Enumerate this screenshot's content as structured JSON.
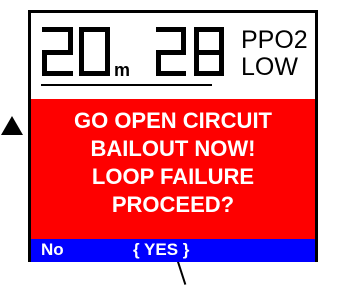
{
  "display": {
    "depth_value": "20",
    "depth_unit": "m",
    "time_value": "28",
    "ppo2_line1": "PPO2",
    "ppo2_line2": "LOW"
  },
  "alert": {
    "lines": [
      "GO OPEN CIRCUIT",
      "BAILOUT NOW!",
      "LOOP FAILURE",
      "PROCEED?"
    ]
  },
  "options": {
    "no_label": "No",
    "yes_label": "{ YES }"
  },
  "colors": {
    "alert_background": "#fe0000",
    "options_bar": "#0000ff",
    "text_on_alert": "#ffffff"
  },
  "icons": [
    "arrow-up-icon",
    "pointer-line-icon"
  ]
}
